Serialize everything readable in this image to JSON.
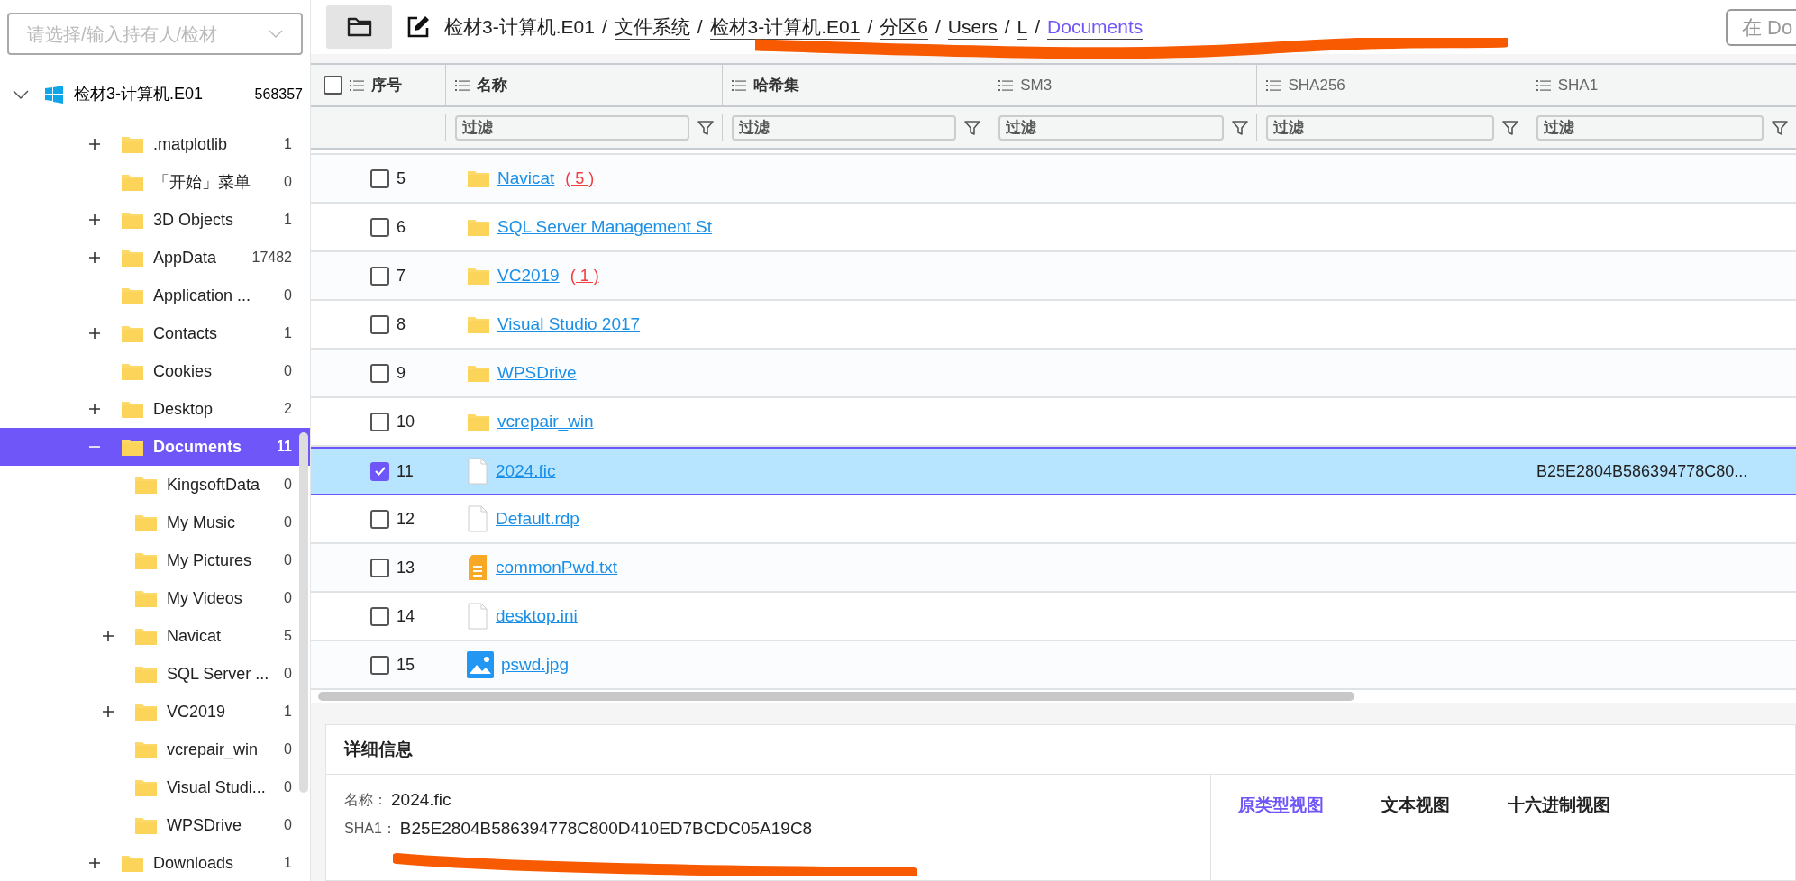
{
  "sidebar": {
    "owner_select": {
      "placeholder": "请选择/输入持有人/检材"
    },
    "tree": {
      "label": "检材3-计算机.E01",
      "count": "568357",
      "expanded": true,
      "selected": false,
      "children": [
        {
          "label": ".matplotlib",
          "count": "1",
          "expanded": false,
          "selected": false
        },
        {
          "label": "「开始」菜单",
          "count": "0",
          "selected": false
        },
        {
          "label": "3D Objects",
          "count": "1",
          "expanded": false,
          "selected": false
        },
        {
          "label": "AppData",
          "count": "17482",
          "expanded": false,
          "selected": false
        },
        {
          "label": "Application ...",
          "count": "0",
          "selected": false
        },
        {
          "label": "Contacts",
          "count": "1",
          "expanded": false,
          "selected": false
        },
        {
          "label": "Cookies",
          "count": "0",
          "selected": false
        },
        {
          "label": "Desktop",
          "count": "2",
          "expanded": false,
          "selected": false
        },
        {
          "label": "Documents",
          "count": "11",
          "expanded": true,
          "selected": true,
          "children": [
            {
              "label": "KingsoftData",
              "count": "0",
              "selected": false
            },
            {
              "label": "My Music",
              "count": "0",
              "selected": false
            },
            {
              "label": "My Pictures",
              "count": "0",
              "selected": false
            },
            {
              "label": "My Videos",
              "count": "0",
              "selected": false
            },
            {
              "label": "Navicat",
              "count": "5",
              "expanded": false,
              "selected": false
            },
            {
              "label": "SQL Server ...",
              "count": "0",
              "selected": false
            },
            {
              "label": "VC2019",
              "count": "1",
              "expanded": false,
              "selected": false
            },
            {
              "label": "vcrepair_win",
              "count": "0",
              "selected": false
            },
            {
              "label": "Visual Studi...",
              "count": "0",
              "selected": false
            },
            {
              "label": "WPSDrive",
              "count": "0",
              "selected": false
            }
          ]
        },
        {
          "label": "Downloads",
          "count": "1",
          "expanded": false,
          "selected": false
        }
      ]
    }
  },
  "breadcrumb": [
    {
      "label": "检材3-计算机.E01",
      "current": false,
      "underlined": false
    },
    {
      "label": "文件系统",
      "current": false,
      "underlined": true
    },
    {
      "label": "检材3-计算机.E01",
      "current": false,
      "underlined": true
    },
    {
      "label": "分区6",
      "current": false,
      "underlined": true
    },
    {
      "label": "Users",
      "current": false,
      "underlined": true
    },
    {
      "label": "L",
      "current": false,
      "underlined": true
    },
    {
      "label": "Documents",
      "current": true,
      "underlined": true
    }
  ],
  "breadcrumb_separator": "/",
  "search": {
    "placeholder": "在 Do"
  },
  "table": {
    "select_all_checked": false,
    "columns": [
      {
        "label": "序号"
      },
      {
        "label": "名称",
        "filter_placeholder": "过滤"
      },
      {
        "label": "哈希集",
        "filter_placeholder": "过滤"
      },
      {
        "label": "SM3",
        "filter_placeholder": "过滤"
      },
      {
        "label": "SHA256",
        "filter_placeholder": "过滤"
      },
      {
        "label": "SHA1",
        "filter_placeholder": "过滤"
      }
    ],
    "rows": [
      {
        "index": "5",
        "name": "Navicat",
        "kind": "folder",
        "count": "( 5 )",
        "checked": false,
        "selected": false
      },
      {
        "index": "6",
        "name": "SQL Server Management St",
        "kind": "folder",
        "checked": false,
        "selected": false
      },
      {
        "index": "7",
        "name": "VC2019",
        "kind": "folder",
        "count": "( 1 )",
        "checked": false,
        "selected": false
      },
      {
        "index": "8",
        "name": "Visual Studio 2017",
        "kind": "folder",
        "checked": false,
        "selected": false
      },
      {
        "index": "9",
        "name": "WPSDrive",
        "kind": "folder",
        "checked": false,
        "selected": false
      },
      {
        "index": "10",
        "name": "vcrepair_win",
        "kind": "folder",
        "checked": false,
        "selected": false
      },
      {
        "index": "11",
        "name": "2024.fic",
        "kind": "file",
        "sha1": "B25E2804B586394778C80...",
        "checked": true,
        "selected": true
      },
      {
        "index": "12",
        "name": "Default.rdp",
        "kind": "file",
        "checked": false,
        "selected": false
      },
      {
        "index": "13",
        "name": "commonPwd.txt",
        "kind": "text",
        "checked": false,
        "selected": false
      },
      {
        "index": "14",
        "name": "desktop.ini",
        "kind": "file",
        "checked": false,
        "selected": false
      },
      {
        "index": "15",
        "name": "pswd.jpg",
        "kind": "image",
        "checked": false,
        "selected": false
      }
    ]
  },
  "details": {
    "title": "详细信息",
    "fields": [
      {
        "label": "名称：",
        "value": "2024.fic"
      },
      {
        "label": "SHA1：",
        "value": "B25E2804B586394778C800D410ED7BCDC05A19C8"
      }
    ],
    "tabs": [
      {
        "label": "原类型视图",
        "selected": true
      },
      {
        "label": "文本视图",
        "selected": false
      },
      {
        "label": "十六进制视图",
        "selected": false
      }
    ]
  }
}
